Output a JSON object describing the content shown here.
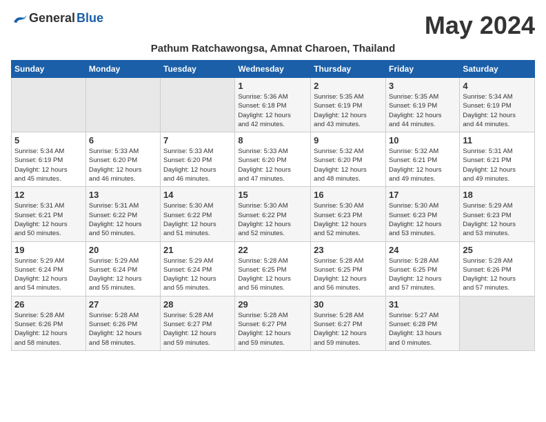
{
  "logo": {
    "general": "General",
    "blue": "Blue"
  },
  "title": "May 2024",
  "subtitle": "Pathum Ratchawongsa, Amnat Charoen, Thailand",
  "days_of_week": [
    "Sunday",
    "Monday",
    "Tuesday",
    "Wednesday",
    "Thursday",
    "Friday",
    "Saturday"
  ],
  "weeks": [
    [
      {
        "num": "",
        "info": ""
      },
      {
        "num": "",
        "info": ""
      },
      {
        "num": "",
        "info": ""
      },
      {
        "num": "1",
        "info": "Sunrise: 5:36 AM\nSunset: 6:18 PM\nDaylight: 12 hours\nand 42 minutes."
      },
      {
        "num": "2",
        "info": "Sunrise: 5:35 AM\nSunset: 6:19 PM\nDaylight: 12 hours\nand 43 minutes."
      },
      {
        "num": "3",
        "info": "Sunrise: 5:35 AM\nSunset: 6:19 PM\nDaylight: 12 hours\nand 44 minutes."
      },
      {
        "num": "4",
        "info": "Sunrise: 5:34 AM\nSunset: 6:19 PM\nDaylight: 12 hours\nand 44 minutes."
      }
    ],
    [
      {
        "num": "5",
        "info": "Sunrise: 5:34 AM\nSunset: 6:19 PM\nDaylight: 12 hours\nand 45 minutes."
      },
      {
        "num": "6",
        "info": "Sunrise: 5:33 AM\nSunset: 6:20 PM\nDaylight: 12 hours\nand 46 minutes."
      },
      {
        "num": "7",
        "info": "Sunrise: 5:33 AM\nSunset: 6:20 PM\nDaylight: 12 hours\nand 46 minutes."
      },
      {
        "num": "8",
        "info": "Sunrise: 5:33 AM\nSunset: 6:20 PM\nDaylight: 12 hours\nand 47 minutes."
      },
      {
        "num": "9",
        "info": "Sunrise: 5:32 AM\nSunset: 6:20 PM\nDaylight: 12 hours\nand 48 minutes."
      },
      {
        "num": "10",
        "info": "Sunrise: 5:32 AM\nSunset: 6:21 PM\nDaylight: 12 hours\nand 49 minutes."
      },
      {
        "num": "11",
        "info": "Sunrise: 5:31 AM\nSunset: 6:21 PM\nDaylight: 12 hours\nand 49 minutes."
      }
    ],
    [
      {
        "num": "12",
        "info": "Sunrise: 5:31 AM\nSunset: 6:21 PM\nDaylight: 12 hours\nand 50 minutes."
      },
      {
        "num": "13",
        "info": "Sunrise: 5:31 AM\nSunset: 6:22 PM\nDaylight: 12 hours\nand 50 minutes."
      },
      {
        "num": "14",
        "info": "Sunrise: 5:30 AM\nSunset: 6:22 PM\nDaylight: 12 hours\nand 51 minutes."
      },
      {
        "num": "15",
        "info": "Sunrise: 5:30 AM\nSunset: 6:22 PM\nDaylight: 12 hours\nand 52 minutes."
      },
      {
        "num": "16",
        "info": "Sunrise: 5:30 AM\nSunset: 6:23 PM\nDaylight: 12 hours\nand 52 minutes."
      },
      {
        "num": "17",
        "info": "Sunrise: 5:30 AM\nSunset: 6:23 PM\nDaylight: 12 hours\nand 53 minutes."
      },
      {
        "num": "18",
        "info": "Sunrise: 5:29 AM\nSunset: 6:23 PM\nDaylight: 12 hours\nand 53 minutes."
      }
    ],
    [
      {
        "num": "19",
        "info": "Sunrise: 5:29 AM\nSunset: 6:24 PM\nDaylight: 12 hours\nand 54 minutes."
      },
      {
        "num": "20",
        "info": "Sunrise: 5:29 AM\nSunset: 6:24 PM\nDaylight: 12 hours\nand 55 minutes."
      },
      {
        "num": "21",
        "info": "Sunrise: 5:29 AM\nSunset: 6:24 PM\nDaylight: 12 hours\nand 55 minutes."
      },
      {
        "num": "22",
        "info": "Sunrise: 5:28 AM\nSunset: 6:25 PM\nDaylight: 12 hours\nand 56 minutes."
      },
      {
        "num": "23",
        "info": "Sunrise: 5:28 AM\nSunset: 6:25 PM\nDaylight: 12 hours\nand 56 minutes."
      },
      {
        "num": "24",
        "info": "Sunrise: 5:28 AM\nSunset: 6:25 PM\nDaylight: 12 hours\nand 57 minutes."
      },
      {
        "num": "25",
        "info": "Sunrise: 5:28 AM\nSunset: 6:26 PM\nDaylight: 12 hours\nand 57 minutes."
      }
    ],
    [
      {
        "num": "26",
        "info": "Sunrise: 5:28 AM\nSunset: 6:26 PM\nDaylight: 12 hours\nand 58 minutes."
      },
      {
        "num": "27",
        "info": "Sunrise: 5:28 AM\nSunset: 6:26 PM\nDaylight: 12 hours\nand 58 minutes."
      },
      {
        "num": "28",
        "info": "Sunrise: 5:28 AM\nSunset: 6:27 PM\nDaylight: 12 hours\nand 59 minutes."
      },
      {
        "num": "29",
        "info": "Sunrise: 5:28 AM\nSunset: 6:27 PM\nDaylight: 12 hours\nand 59 minutes."
      },
      {
        "num": "30",
        "info": "Sunrise: 5:28 AM\nSunset: 6:27 PM\nDaylight: 12 hours\nand 59 minutes."
      },
      {
        "num": "31",
        "info": "Sunrise: 5:27 AM\nSunset: 6:28 PM\nDaylight: 13 hours\nand 0 minutes."
      },
      {
        "num": "",
        "info": ""
      }
    ]
  ]
}
